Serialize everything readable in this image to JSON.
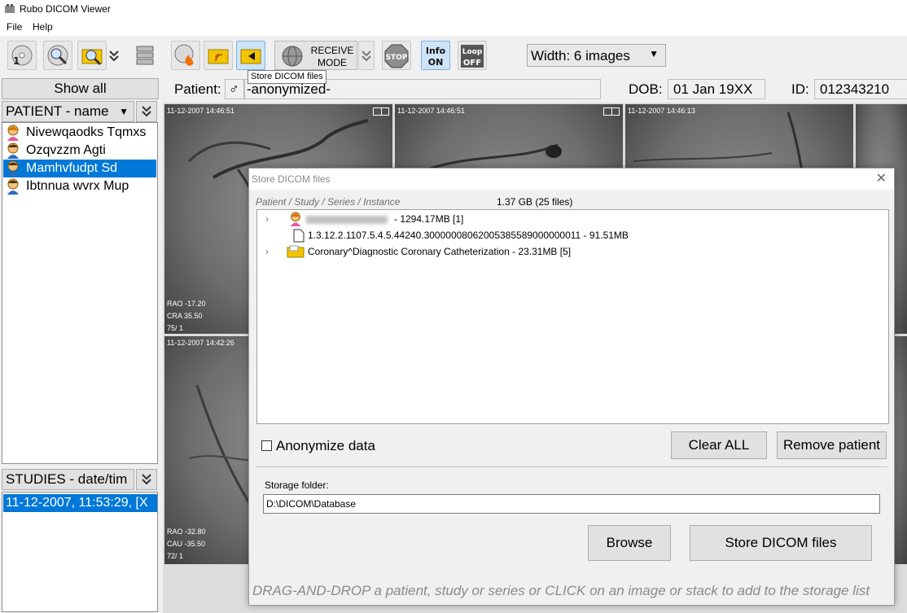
{
  "window": {
    "title": "Rubo DICOM Viewer"
  },
  "menu": {
    "items": [
      "File",
      "Help"
    ]
  },
  "toolbar": {
    "receive_line1": "RECEIVE",
    "receive_line2": "MODE",
    "stop_label": "STOP",
    "info_label_top": "Info",
    "info_label_bottom": "ON",
    "loop_label_top": "Loop",
    "loop_label_bottom": "OFF",
    "width_value": "Width: 6 images",
    "tooltip": "Store DICOM files"
  },
  "left_panel": {
    "show_all": "Show all",
    "patient_sort": "PATIENT - name",
    "patients": [
      {
        "name": "Nivewqaodks Tqmxs",
        "gender": "female"
      },
      {
        "name": "Ozqvzzm Agti",
        "gender": "male"
      },
      {
        "name": "Mamhvfudpt Sd",
        "gender": "male",
        "selected": true
      },
      {
        "name": "Ibtnnua wvrx Mup",
        "gender": "male"
      }
    ],
    "studies_sort": "STUDIES - date/tim",
    "study_row": "11-12-2007, 11:53:29, [X"
  },
  "patient_bar": {
    "patient_label": "Patient:",
    "gender_symbol": "♂",
    "patient_value": "-anonymized-",
    "dob_label": "DOB:",
    "dob_value": "01 Jan 19XX",
    "id_label": "ID:",
    "id_value": "012343210"
  },
  "tiles": [
    {
      "ts": "11-12-2007  14:46:51",
      "ang1": "RAO -17.20",
      "ang2": "CRA 35.50",
      "frame": "75/ 1"
    },
    {
      "ts": "11-12-2007  14:46:51"
    },
    {
      "ts": "11-12-2007  14:46:13"
    },
    {
      "ts": "11-12-2007  14:42:26",
      "ang1": "RAO -32.80",
      "ang2": "CAU -35.50",
      "frame": "72/ 1"
    }
  ],
  "dialog": {
    "title": "Store DICOM files",
    "tree_header": "Patient / Study / Series / Instance",
    "total_size": "1.37 GB  (25 files)",
    "tree_rows": [
      {
        "text": "-  1294.17MB  [1]"
      },
      {
        "text": "1.3.12.2.1107.5.4.5.44240.30000008062005385589000000011  -  91.51MB"
      },
      {
        "text": "Coronary^Diagnostic Coronary Catheterization  -  23.31MB  [5]"
      }
    ],
    "anonymize_label": "Anonymize data",
    "clear_all": "Clear ALL",
    "remove_patient": "Remove patient",
    "storage_label": "Storage folder:",
    "storage_path": "D:\\DICOM\\Database",
    "browse": "Browse",
    "store": "Store DICOM files",
    "hint": "DRAG-AND-DROP a patient, study or series or CLICK on an image or stack to add to the storage list"
  }
}
